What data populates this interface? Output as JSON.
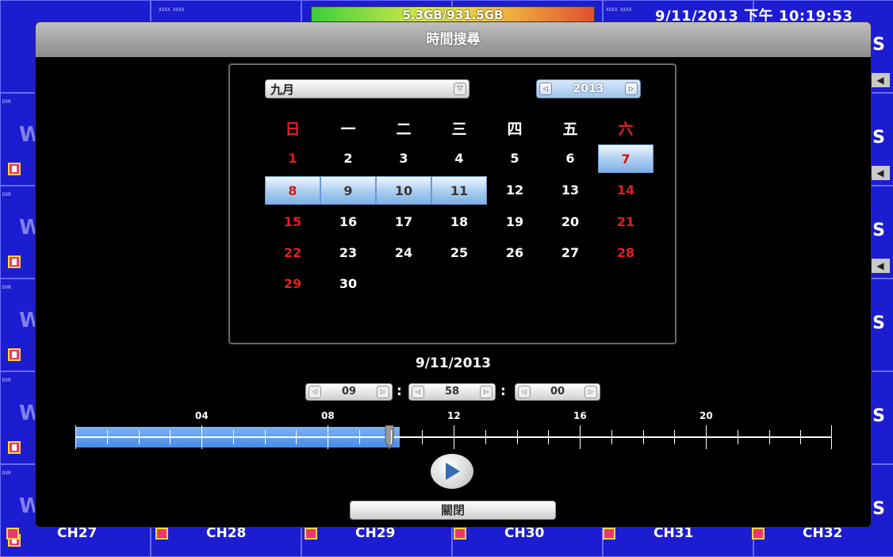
{
  "top": {
    "storage": "5.3GB/931.5GB",
    "datetime": "9/11/2013 下午 10:19:53",
    "small_label": "XXXX XXXX"
  },
  "tiles": {
    "label": "DVR",
    "w_text": "W",
    "s_text": "S"
  },
  "channels": [
    "CH27",
    "CH28",
    "CH29",
    "CH30",
    "CH31",
    "CH32"
  ],
  "dialog": {
    "title": "時間搜尋",
    "month": "九月",
    "year": "2013",
    "weekdays": [
      "日",
      "一",
      "二",
      "三",
      "四",
      "五",
      "六"
    ],
    "days": [
      {
        "d": "1",
        "col": 0,
        "row": 0
      },
      {
        "d": "2",
        "col": 1,
        "row": 0
      },
      {
        "d": "3",
        "col": 2,
        "row": 0
      },
      {
        "d": "4",
        "col": 3,
        "row": 0
      },
      {
        "d": "5",
        "col": 4,
        "row": 0
      },
      {
        "d": "6",
        "col": 5,
        "row": 0
      },
      {
        "d": "7",
        "col": 6,
        "row": 0
      },
      {
        "d": "8",
        "col": 0,
        "row": 1
      },
      {
        "d": "9",
        "col": 1,
        "row": 1
      },
      {
        "d": "10",
        "col": 2,
        "row": 1
      },
      {
        "d": "11",
        "col": 3,
        "row": 1
      },
      {
        "d": "12",
        "col": 4,
        "row": 1
      },
      {
        "d": "13",
        "col": 5,
        "row": 1
      },
      {
        "d": "14",
        "col": 6,
        "row": 1
      },
      {
        "d": "15",
        "col": 0,
        "row": 2
      },
      {
        "d": "16",
        "col": 1,
        "row": 2
      },
      {
        "d": "17",
        "col": 2,
        "row": 2
      },
      {
        "d": "18",
        "col": 3,
        "row": 2
      },
      {
        "d": "19",
        "col": 4,
        "row": 2
      },
      {
        "d": "20",
        "col": 5,
        "row": 2
      },
      {
        "d": "21",
        "col": 6,
        "row": 2
      },
      {
        "d": "22",
        "col": 0,
        "row": 3
      },
      {
        "d": "23",
        "col": 1,
        "row": 3
      },
      {
        "d": "24",
        "col": 2,
        "row": 3
      },
      {
        "d": "25",
        "col": 3,
        "row": 3
      },
      {
        "d": "26",
        "col": 4,
        "row": 3
      },
      {
        "d": "27",
        "col": 5,
        "row": 3
      },
      {
        "d": "28",
        "col": 6,
        "row": 3
      },
      {
        "d": "29",
        "col": 0,
        "row": 4
      },
      {
        "d": "30",
        "col": 1,
        "row": 4
      }
    ],
    "recorded_days": [
      "7",
      "8",
      "9",
      "10",
      "11"
    ],
    "selected_date": "9/11/2013",
    "hour": "09",
    "minute": "58",
    "second": "00",
    "timeline_labels": [
      "04",
      "08",
      "12",
      "16",
      "20"
    ],
    "timeline_recorded_until_hour": 10.3,
    "timeline_thumb_hour": 9.97,
    "close_label": "關閉",
    "colors": {
      "accent": "#4a8ae8",
      "weekend": "#e02020"
    }
  }
}
